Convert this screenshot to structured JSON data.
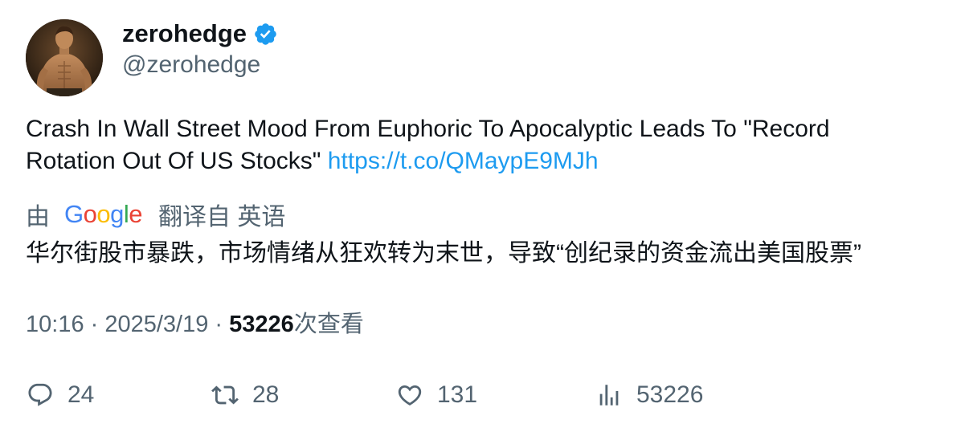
{
  "author": {
    "display_name": "zerohedge",
    "handle": "@zerohedge",
    "verified": true
  },
  "tweet": {
    "text": "Crash In Wall Street Mood From Euphoric To Apocalyptic Leads To \"Record Rotation Out Of US Stocks\" ",
    "link": "https://t.co/QMaypE9MJh"
  },
  "translation": {
    "by_label": "由",
    "provider": "Google",
    "from_label": "翻译自 英语",
    "text": "华尔街股市暴跌，市场情绪从狂欢转为末世，导致“创纪录的资金流出美国股票”"
  },
  "meta": {
    "time": "10:16",
    "separator1": " · ",
    "date": "2025/3/19",
    "separator2": " · ",
    "views_count": "53226",
    "views_label": "次查看"
  },
  "actions": {
    "replies": "24",
    "retweets": "28",
    "likes": "131",
    "views": "53226"
  },
  "colors": {
    "text_primary": "#0f1419",
    "text_secondary": "#536471",
    "link": "#1d9bf0",
    "verified": "#1d9bf0"
  },
  "icons": [
    "verified-badge-icon",
    "reply-icon",
    "retweet-icon",
    "like-icon",
    "views-icon",
    "google-logo"
  ]
}
